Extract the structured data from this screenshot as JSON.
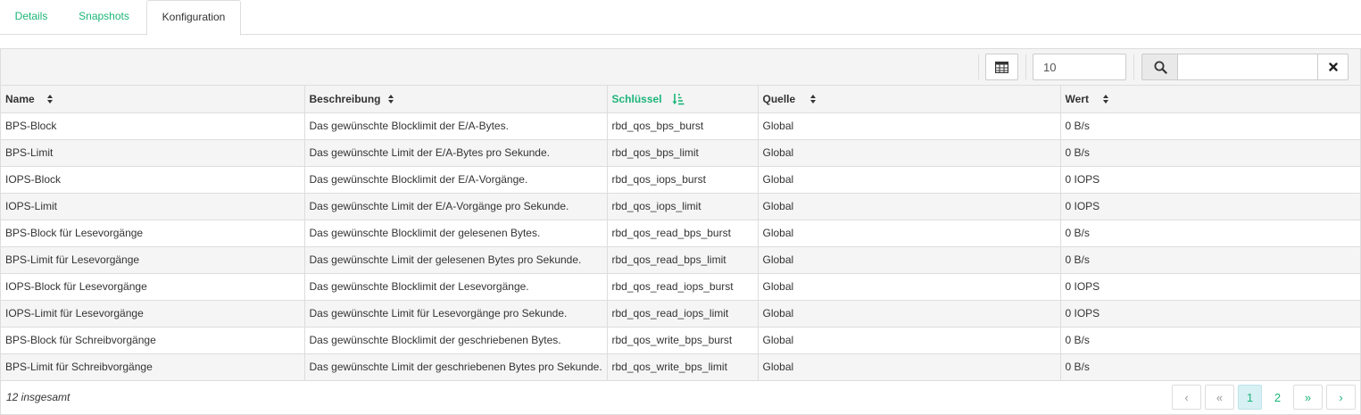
{
  "tabs": [
    {
      "label": "Details",
      "active": false
    },
    {
      "label": "Snapshots",
      "active": false
    },
    {
      "label": "Konfiguration",
      "active": true
    }
  ],
  "toolbar": {
    "limit_value": "10",
    "search_value": "",
    "columns_icon": "table-grid-icon",
    "search_icon": "search-icon",
    "clear_icon": "close-icon"
  },
  "table": {
    "columns": [
      {
        "label": "Name",
        "sorted": false
      },
      {
        "label": "Beschreibung",
        "sorted": false
      },
      {
        "label": "Schlüssel",
        "sorted": true
      },
      {
        "label": "Quelle",
        "sorted": false
      },
      {
        "label": "Wert",
        "sorted": false
      }
    ],
    "rows": [
      [
        "BPS-Block",
        "Das gewünschte Blocklimit der E/A-Bytes.",
        "rbd_qos_bps_burst",
        "Global",
        "0 B/s"
      ],
      [
        "BPS-Limit",
        "Das gewünschte Limit der E/A-Bytes pro Sekunde.",
        "rbd_qos_bps_limit",
        "Global",
        "0 B/s"
      ],
      [
        "IOPS-Block",
        "Das gewünschte Blocklimit der E/A-Vorgänge.",
        "rbd_qos_iops_burst",
        "Global",
        "0 IOPS"
      ],
      [
        "IOPS-Limit",
        "Das gewünschte Limit der E/A-Vorgänge pro Sekunde.",
        "rbd_qos_iops_limit",
        "Global",
        "0 IOPS"
      ],
      [
        "BPS-Block für Lesevorgänge",
        "Das gewünschte Blocklimit der gelesenen Bytes.",
        "rbd_qos_read_bps_burst",
        "Global",
        "0 B/s"
      ],
      [
        "BPS-Limit für Lesevorgänge",
        "Das gewünschte Limit der gelesenen Bytes pro Sekunde.",
        "rbd_qos_read_bps_limit",
        "Global",
        "0 B/s"
      ],
      [
        "IOPS-Block für Lesevorgänge",
        "Das gewünschte Blocklimit der Lesevorgänge.",
        "rbd_qos_read_iops_burst",
        "Global",
        "0 IOPS"
      ],
      [
        "IOPS-Limit für Lesevorgänge",
        "Das gewünschte Limit für Lesevorgänge pro Sekunde.",
        "rbd_qos_read_iops_limit",
        "Global",
        "0 IOPS"
      ],
      [
        "BPS-Block für Schreibvorgänge",
        "Das gewünschte Blocklimit der geschriebenen Bytes.",
        "rbd_qos_write_bps_burst",
        "Global",
        "0 B/s"
      ],
      [
        "BPS-Limit für Schreibvorgänge",
        "Das gewünschte Limit der geschriebenen Bytes pro Sekunde.",
        "rbd_qos_write_bps_limit",
        "Global",
        "0 B/s"
      ]
    ]
  },
  "footer": {
    "total_text": "12 insgesamt",
    "pager": {
      "prev": "‹",
      "first": "«",
      "pages": [
        "1",
        "2"
      ],
      "current_page": "1",
      "last": "»",
      "next": "›"
    }
  },
  "colors": {
    "accent": "#1cb57a",
    "active_page_bg": "#d6f0f3"
  }
}
